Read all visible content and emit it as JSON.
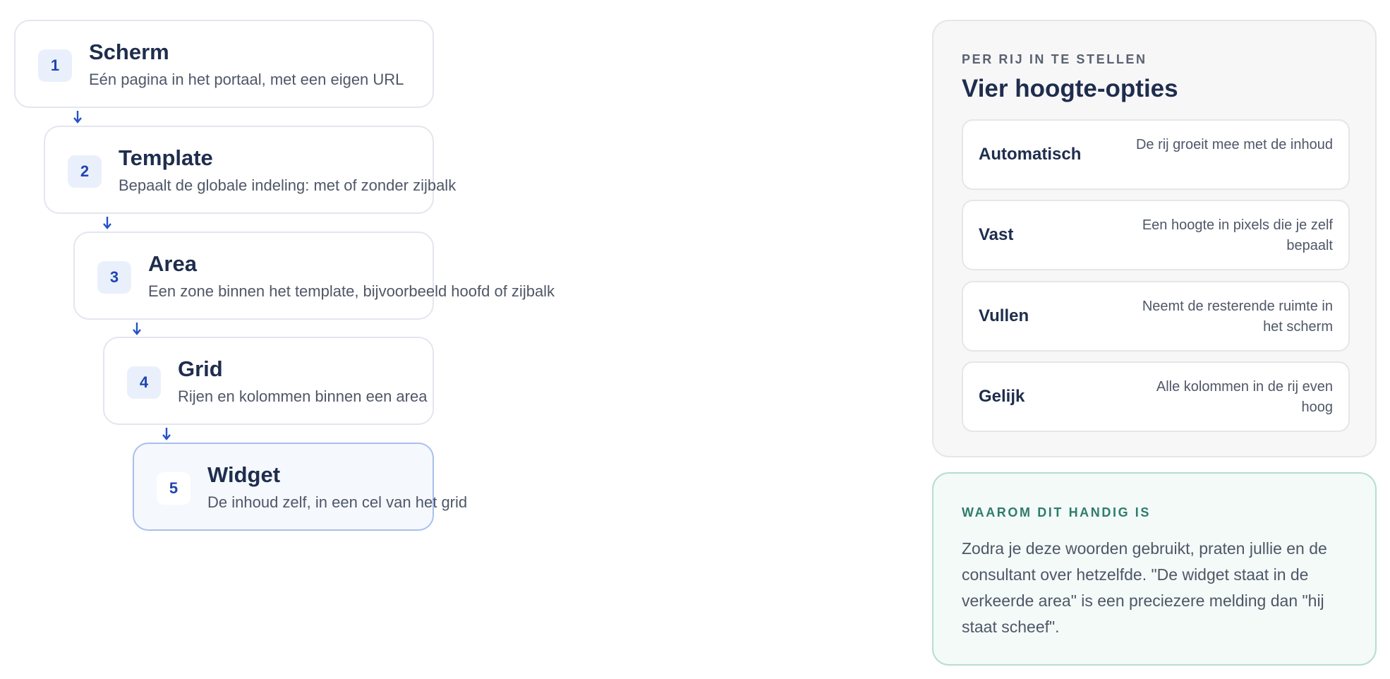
{
  "levels": [
    {
      "number": "1",
      "title": "Scherm",
      "description": "Eén pagina in het portaal, met een eigen URL"
    },
    {
      "number": "2",
      "title": "Template",
      "description": "Bepaalt de globale indeling: met of zonder zijbalk"
    },
    {
      "number": "3",
      "title": "Area",
      "description": "Een zone binnen het template, bijvoorbeeld hoofd of zijbalk"
    },
    {
      "number": "4",
      "title": "Grid",
      "description": "Rijen en kolommen binnen een area"
    },
    {
      "number": "5",
      "title": "Widget",
      "description": "De inhoud zelf, in een cel van het grid"
    }
  ],
  "height_options": {
    "eyebrow": "PER RIJ IN TE STELLEN",
    "title": "Vier hoogte-opties",
    "options": [
      {
        "name": "Automatisch",
        "description": "De rij groeit mee met de inhoud"
      },
      {
        "name": "Vast",
        "description": "Een hoogte in pixels die je zelf bepaalt"
      },
      {
        "name": "Vullen",
        "description": "Neemt de resterende ruimte in het scherm"
      },
      {
        "name": "Gelijk",
        "description": "Alle kolommen in de rij even hoog"
      }
    ]
  },
  "why": {
    "eyebrow": "WAAROM DIT HANDIG IS",
    "text": "Zodra je deze woorden gebruikt, praten jullie en de consultant over hetzelfde. \"De widget staat in de verkeerde area\" is een preciezere melding dan \"hij staat scheef\"."
  },
  "colors": {
    "accent": "#1f45b0",
    "arrow": "#2450c9",
    "heading": "#1f2d4d",
    "highlight_border": "#a9c0ec",
    "why_accent": "#2f7c6a"
  }
}
